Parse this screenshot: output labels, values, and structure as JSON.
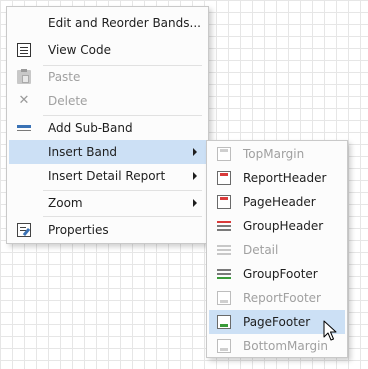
{
  "main_menu": {
    "edit_bands": "Edit and Reorder Bands...",
    "view_code": "View Code",
    "paste": "Paste",
    "delete": "Delete",
    "add_sub_band": "Add Sub-Band",
    "insert_band": "Insert Band",
    "insert_detail_report": "Insert Detail Report",
    "zoom": "Zoom",
    "properties": "Properties"
  },
  "insert_band_submenu": {
    "items": [
      {
        "label": "TopMargin",
        "enabled": false,
        "icon": "top-margin-icon"
      },
      {
        "label": "ReportHeader",
        "enabled": true,
        "icon": "report-header-icon"
      },
      {
        "label": "PageHeader",
        "enabled": true,
        "icon": "page-header-icon"
      },
      {
        "label": "GroupHeader",
        "enabled": true,
        "icon": "group-header-icon"
      },
      {
        "label": "Detail",
        "enabled": false,
        "icon": "detail-icon"
      },
      {
        "label": "GroupFooter",
        "enabled": true,
        "icon": "group-footer-icon"
      },
      {
        "label": "ReportFooter",
        "enabled": false,
        "icon": "report-footer-icon"
      },
      {
        "label": "PageFooter",
        "enabled": true,
        "icon": "page-footer-icon"
      },
      {
        "label": "BottomMargin",
        "enabled": false,
        "icon": "bottom-margin-icon"
      }
    ]
  },
  "colors": {
    "highlight": "#cce0f5",
    "disabled_text": "#a0a0a0",
    "band_red": "#d93a3a",
    "band_green": "#3a9b3a"
  }
}
